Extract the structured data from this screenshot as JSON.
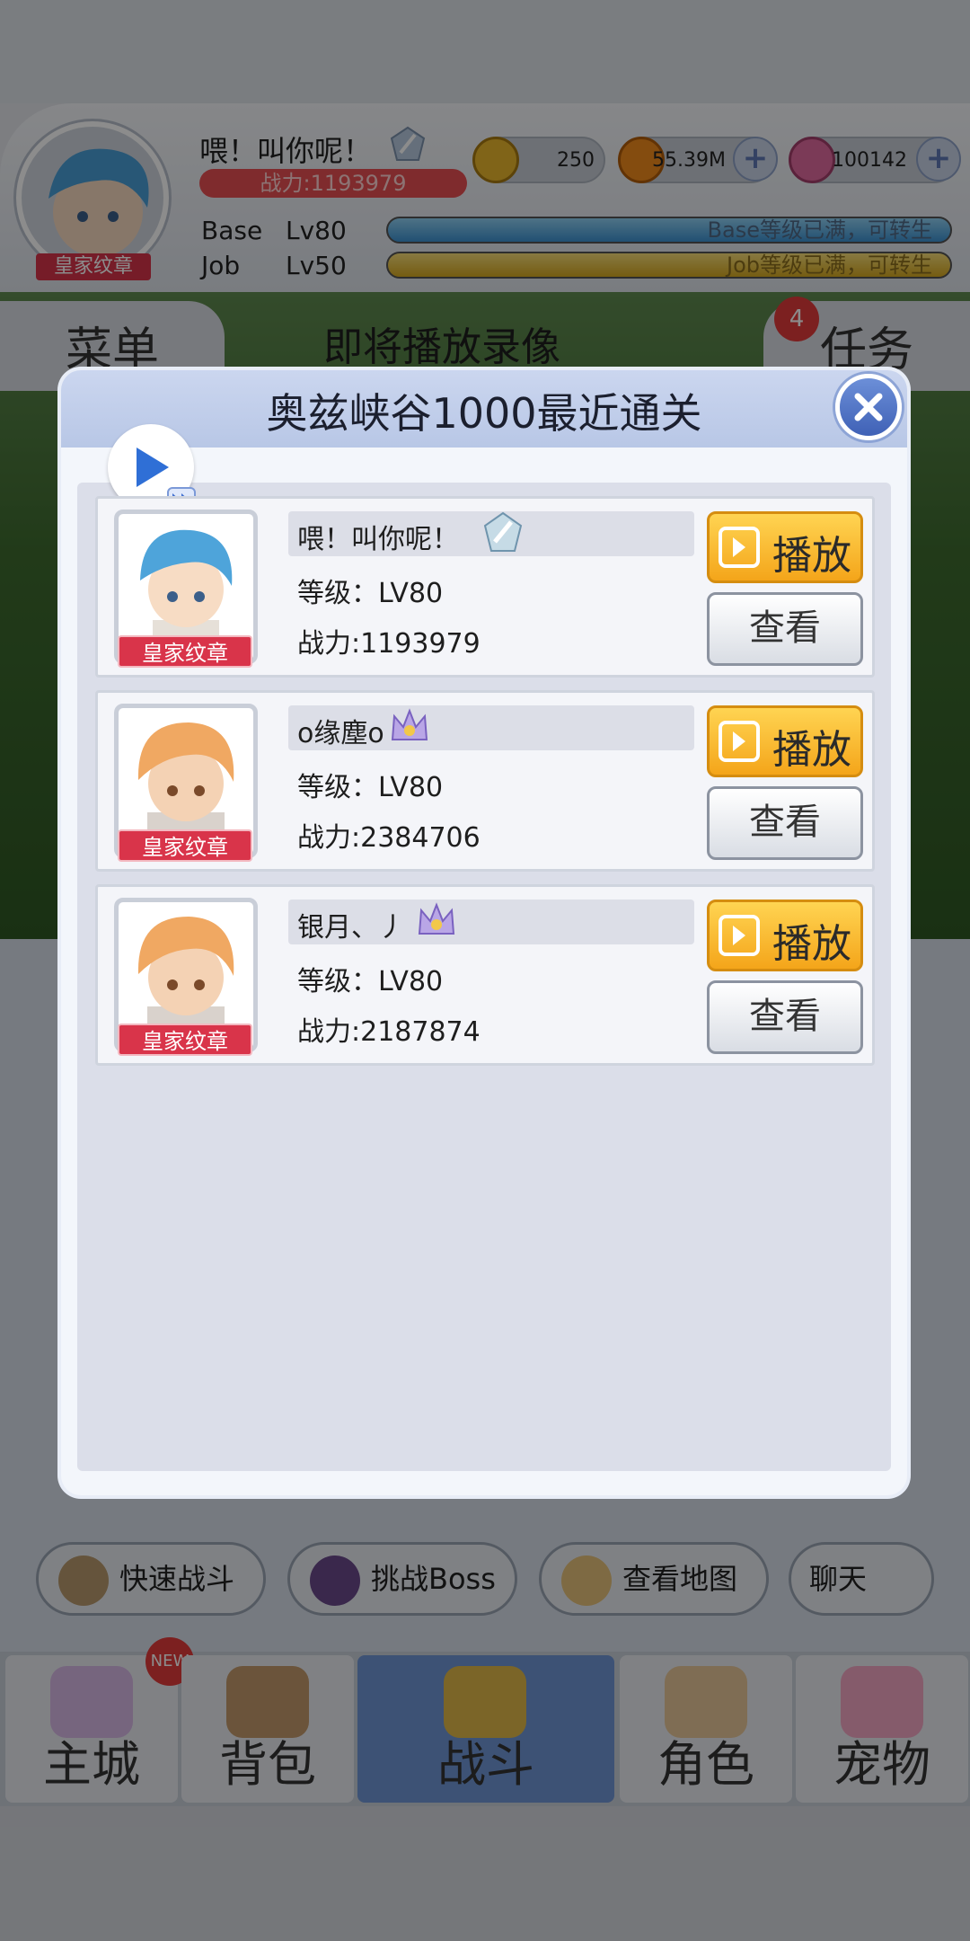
{
  "hud": {
    "player_name": "喂！叫你呢！",
    "power": "战力:1193979",
    "badge": "皇家纹章",
    "zeny": "250",
    "gold": "55.39M",
    "gems": "100142",
    "base_label": "Base",
    "base_level": "Lv80",
    "base_status": "Base等级已满，可转生",
    "job_label": "Job",
    "job_level": "Lv50",
    "job_status": "Job等级已满，可转生"
  },
  "tabs": {
    "menu": "菜单",
    "replay": "即将播放录像",
    "tasks": "任务",
    "task_count": "4"
  },
  "actions": {
    "quick_battle": "快速战斗",
    "boss": "挑战Boss",
    "map": "查看地图",
    "chat": "聊天"
  },
  "nav": {
    "new_badge": "NEW",
    "items": [
      {
        "label": "主城"
      },
      {
        "label": "背包"
      },
      {
        "label": "战斗"
      },
      {
        "label": "角色"
      },
      {
        "label": "宠物"
      }
    ]
  },
  "modal": {
    "title": "奥兹峡谷1000最近通关",
    "rows": [
      {
        "name": "喂！叫你呢！",
        "level": "等级：LV80",
        "power": "战力:1193979",
        "medal": "皇家纹章",
        "play": "播放",
        "view": "查看"
      },
      {
        "name": "o缘塵o",
        "level": "等级：LV80",
        "power": "战力:2384706",
        "medal": "皇家纹章",
        "play": "播放",
        "view": "查看"
      },
      {
        "name": "银月、丿",
        "level": "等级：LV80",
        "power": "战力:2187874",
        "medal": "皇家纹章",
        "play": "播放",
        "view": "查看"
      }
    ]
  },
  "colors": {
    "play_button": "#f4a51a",
    "modal_header": "#b8c7e6",
    "close_button": "#3f61b6",
    "medal_red": "#d9344a"
  }
}
